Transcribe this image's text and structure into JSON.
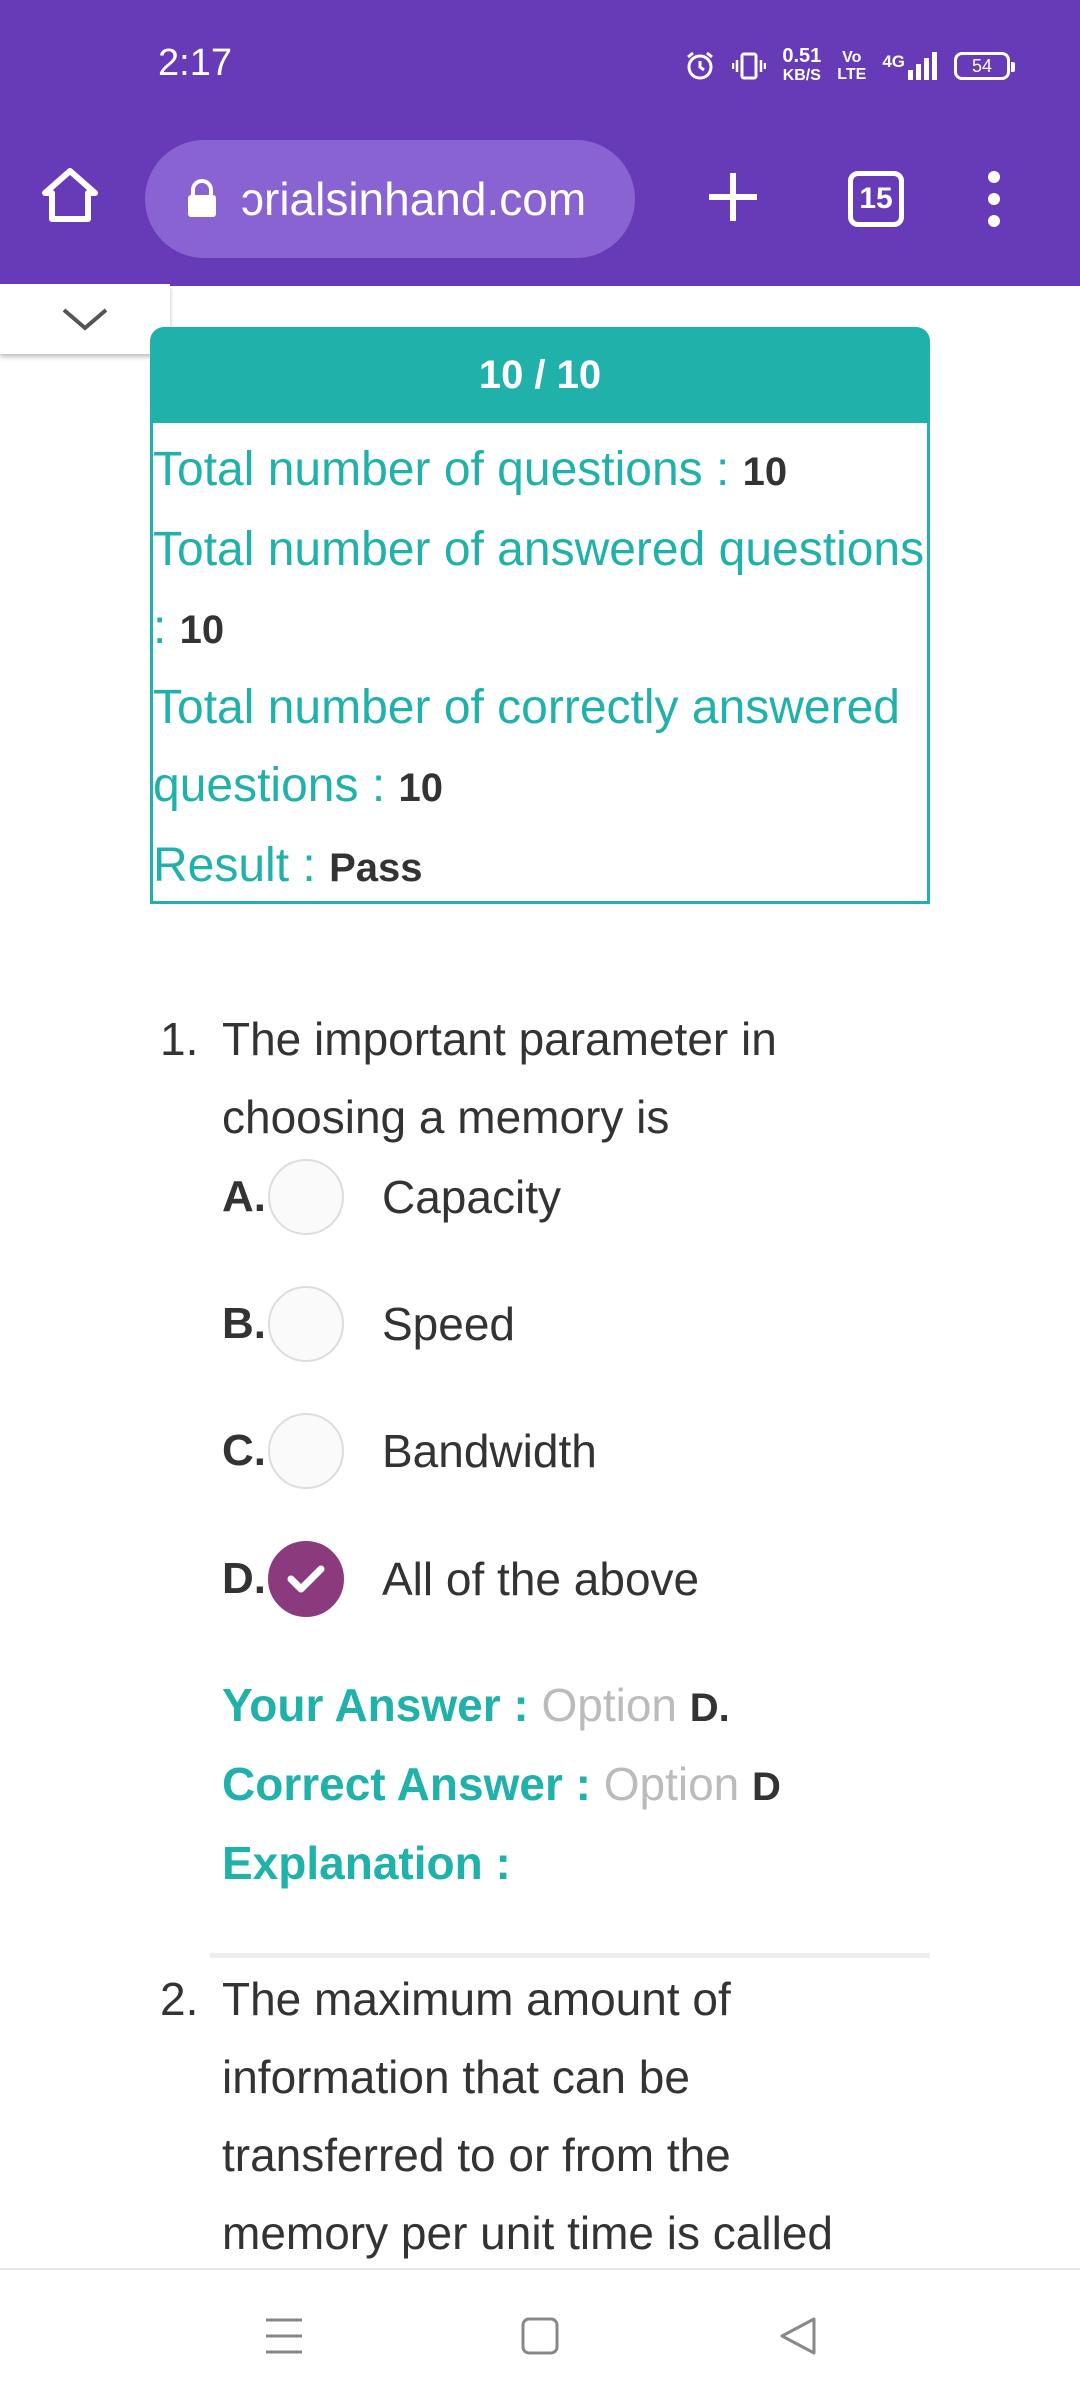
{
  "status_bar": {
    "time": "2:17",
    "net_speed_value": "0.51",
    "net_speed_unit": "KB/S",
    "volte_top": "Vo",
    "volte_bottom": "LTE",
    "network": "4G",
    "battery": "54"
  },
  "browser": {
    "url": "ɔrialsinhand.com",
    "tab_count": "15",
    "icons": [
      "home-icon",
      "lock-icon",
      "plus-icon",
      "tabs-icon",
      "more-vert-icon",
      "chevron-down-icon"
    ]
  },
  "result": {
    "score": "10 / 10",
    "total_questions_label": "Total number of questions : ",
    "total_questions_value": "10",
    "answered_label_1": "Total number of answered questions",
    "answered_label_2": ": ",
    "answered_value": "10",
    "correct_label_1": "Total number of correctly answered",
    "correct_label_2": "questions : ",
    "correct_value": "10",
    "result_label": "Result : ",
    "result_value": "Pass"
  },
  "questions": [
    {
      "number": "1.",
      "text_line1": "The important parameter in",
      "text_line2": "choosing a memory is",
      "options": [
        {
          "letter": "A.",
          "text": "Capacity",
          "selected": false
        },
        {
          "letter": "B.",
          "text": "Speed",
          "selected": false
        },
        {
          "letter": "C.",
          "text": "Bandwidth",
          "selected": false
        },
        {
          "letter": "D.",
          "text": "All of the above",
          "selected": true
        }
      ],
      "your_answer_label": "Your Answer : ",
      "your_answer_option": "Option ",
      "your_answer_value": "D.",
      "correct_answer_label": "Correct Answer : ",
      "correct_answer_option": "Option ",
      "correct_answer_value": "D",
      "explanation_label": "Explanation :"
    },
    {
      "number": "2.",
      "text_line1": "The maximum amount of",
      "text_line2": "information that can be",
      "text_line3": "transferred to or from the",
      "text_line4": "memory per unit time is called"
    }
  ],
  "colors": {
    "browser_bar": "#673ab7",
    "accent": "#20b2aa",
    "selected_radio": "#8b3a7e"
  },
  "nav_icons": [
    "menu-lines-icon",
    "square-home-icon",
    "triangle-back-icon"
  ]
}
